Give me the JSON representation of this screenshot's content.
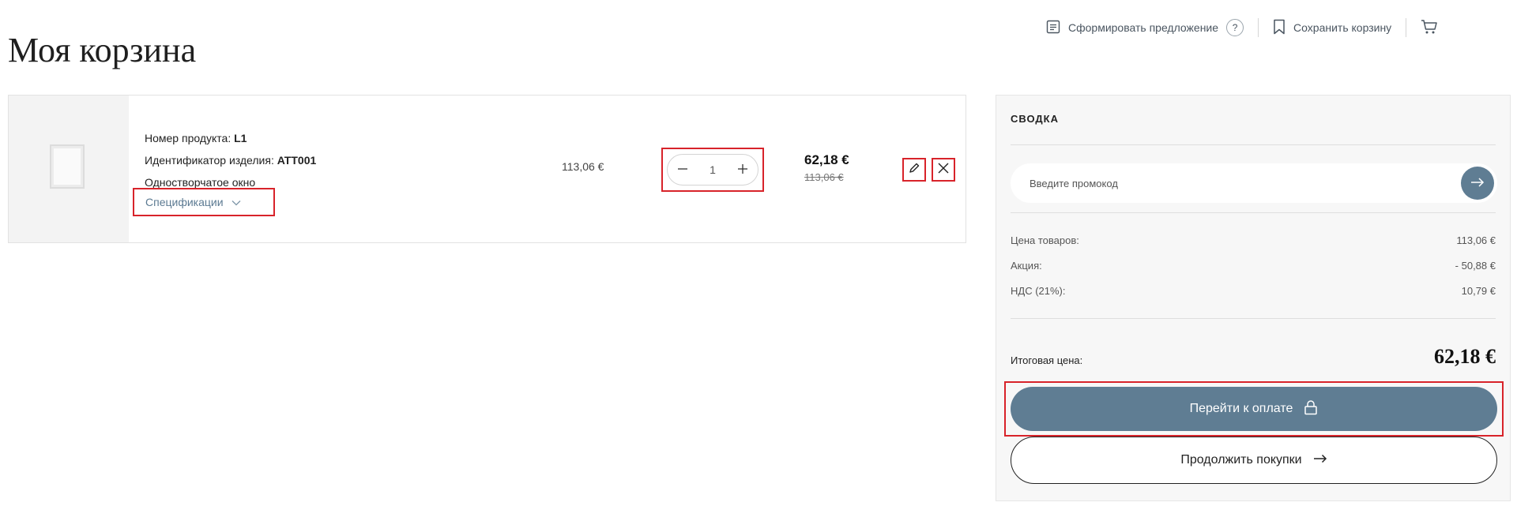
{
  "page": {
    "title": "Моя корзина"
  },
  "toolbar": {
    "offer_label": "Сформировать предложение",
    "help_label": "?",
    "save_label": "Сохранить корзину"
  },
  "cart_item": {
    "product_number_label": "Номер продукта: ",
    "product_number_value": "L1",
    "item_id_label": "Идентификатор изделия: ",
    "item_id_value": "ATT001",
    "name": "Одностворчатое окно",
    "specs_label": "Спецификации",
    "unit_price": "113,06 €",
    "quantity": "1",
    "price_now": "62,18 €",
    "price_old": "113,06 €",
    "thumbnail_icon": "window-thumbnail"
  },
  "summary": {
    "title": "СВОДКА",
    "promo_placeholder": "Введите промокод",
    "lines": [
      {
        "label": "Цена товаров:",
        "value": "113,06 €"
      },
      {
        "label": "Акция:",
        "value": "- 50,88 €"
      },
      {
        "label": "НДС (21%):",
        "value": "10,79 €"
      }
    ],
    "total_label": "Итоговая цена:",
    "total_value": "62,18 €",
    "checkout_label": "Перейти к оплате",
    "continue_label": "Продолжить покупки"
  },
  "colors": {
    "accent": "#5f7d93",
    "highlight_border": "#d8232a",
    "link": "#5c7a92"
  }
}
